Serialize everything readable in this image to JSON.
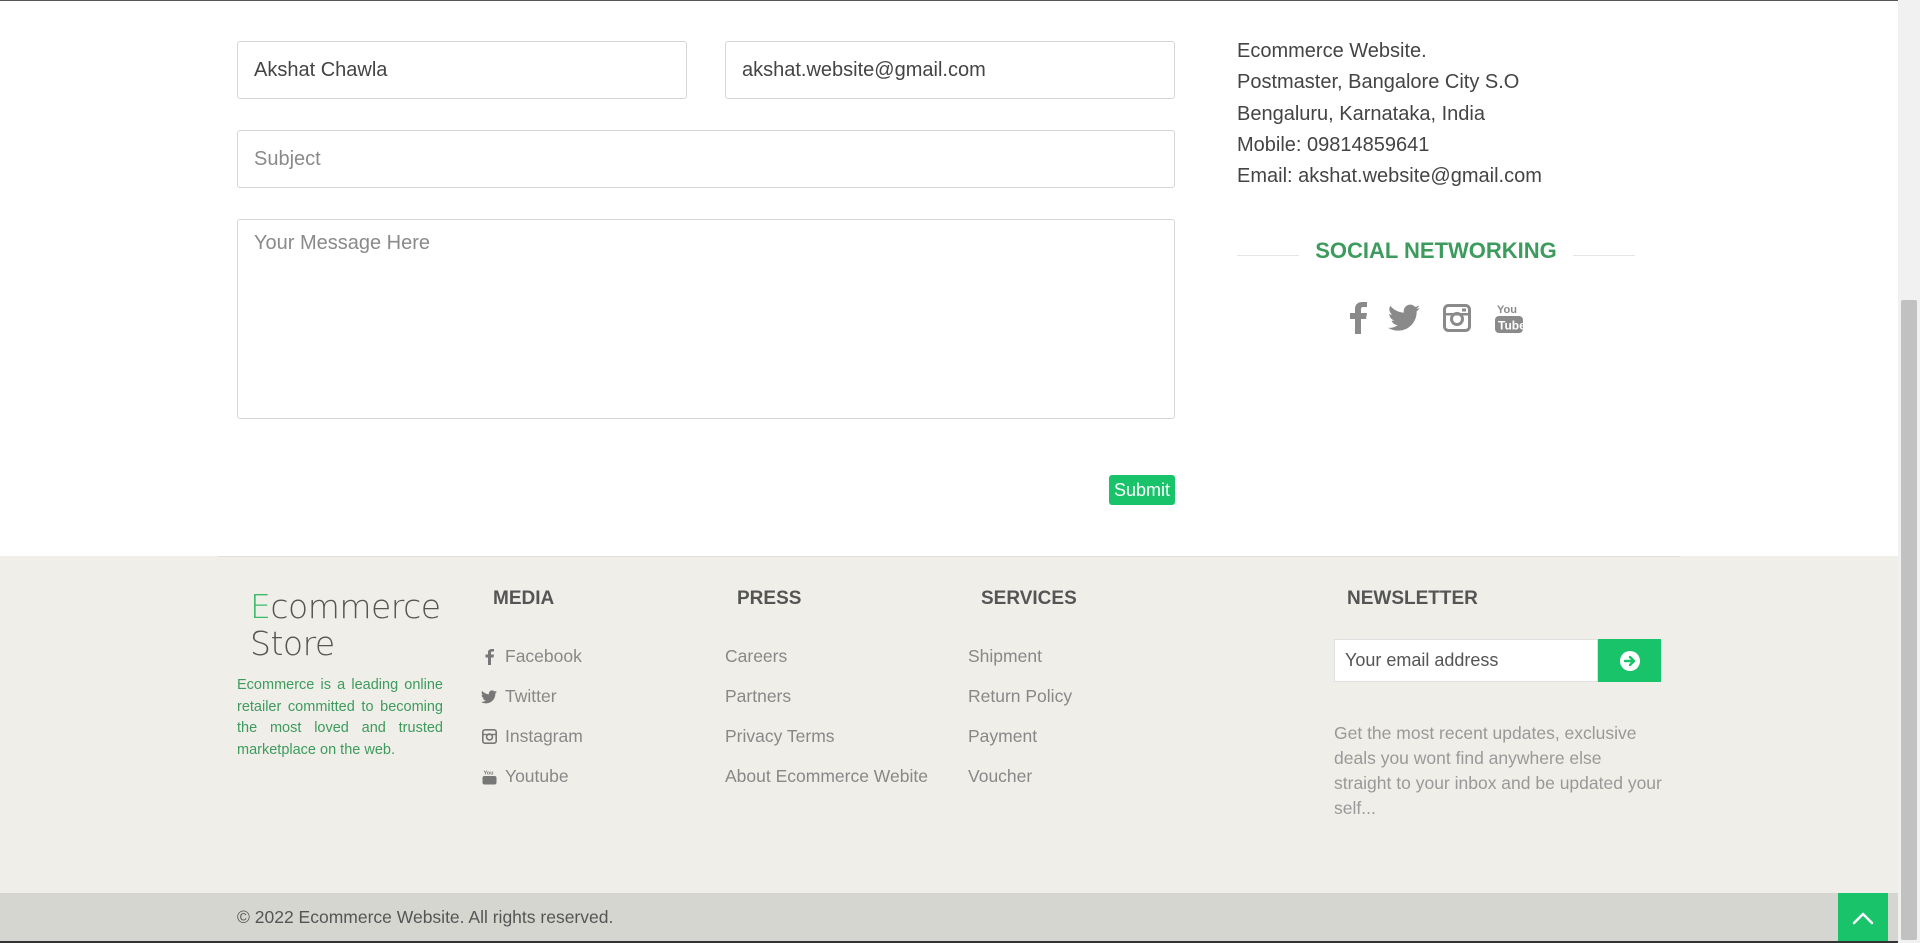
{
  "contact_form": {
    "name_value": "Akshat Chawla",
    "email_value": "akshat.website@gmail.com",
    "subject_placeholder": "Subject",
    "message_placeholder": "Your Message Here",
    "submit_label": "Submit"
  },
  "address": {
    "line1": "Ecommerce Website.",
    "line2": "Postmaster, Bangalore City S.O",
    "line3": "Bengaluru, Karnataka, India",
    "mobile": "Mobile: 09814859641",
    "email": "Email: akshat.website@gmail.com"
  },
  "social": {
    "title": "SOCIAL NETWORKING",
    "icons": [
      "facebook-icon",
      "twitter-icon",
      "instagram-icon",
      "youtube-icon"
    ]
  },
  "footer": {
    "logo_first_letter": "E",
    "logo_rest_line1": "commerce",
    "logo_line2": "Store",
    "about": "Ecommerce is a leading online retailer committed to becoming the most loved and trusted marketplace on the web.",
    "media": {
      "title": "MEDIA",
      "links": [
        "Facebook",
        "Twitter",
        "Instagram",
        "Youtube"
      ]
    },
    "press": {
      "title": "PRESS",
      "links": [
        "Careers",
        "Partners",
        "Privacy Terms",
        "About Ecommerce Webite"
      ]
    },
    "services": {
      "title": "SERVICES",
      "links": [
        "Shipment",
        "Return Policy",
        "Payment",
        "Voucher"
      ]
    },
    "newsletter": {
      "title": "NEWSLETTER",
      "placeholder": "Your email address",
      "description": "Get the most recent updates, exclusive deals you wont find anywhere else straight to your inbox and be updated your self..."
    },
    "copyright": "© 2022 Ecommerce Website. All rights reserved."
  },
  "colors": {
    "accent_green": "#19c36a",
    "heading_green": "#3d9b5e",
    "footer_bg": "#efeee8",
    "bottom_bar_bg": "#d6d6d1"
  }
}
